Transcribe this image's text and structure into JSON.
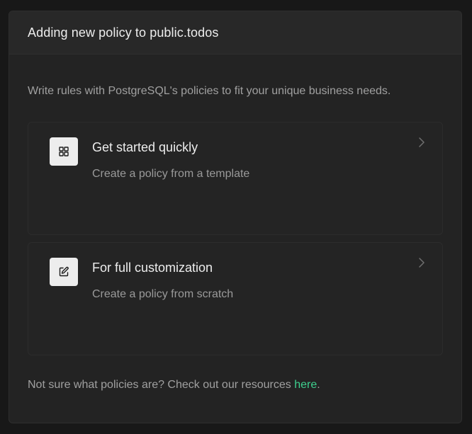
{
  "dialog": {
    "title": "Adding new policy to public.todos",
    "intro": "Write rules with PostgreSQL's policies to fit your unique business needs."
  },
  "options": [
    {
      "title": "Get started quickly",
      "subtitle": "Create a policy from a template",
      "icon": "grid-icon"
    },
    {
      "title": "For full customization",
      "subtitle": "Create a policy from scratch",
      "icon": "edit-icon"
    }
  ],
  "footer": {
    "prefix": "Not sure what policies are? Check out our resources ",
    "link_label": "here",
    "suffix": "."
  },
  "colors": {
    "background": "#181818",
    "panel": "#232323",
    "accent_link": "#3ecf8e",
    "icon_box": "#ededed"
  }
}
